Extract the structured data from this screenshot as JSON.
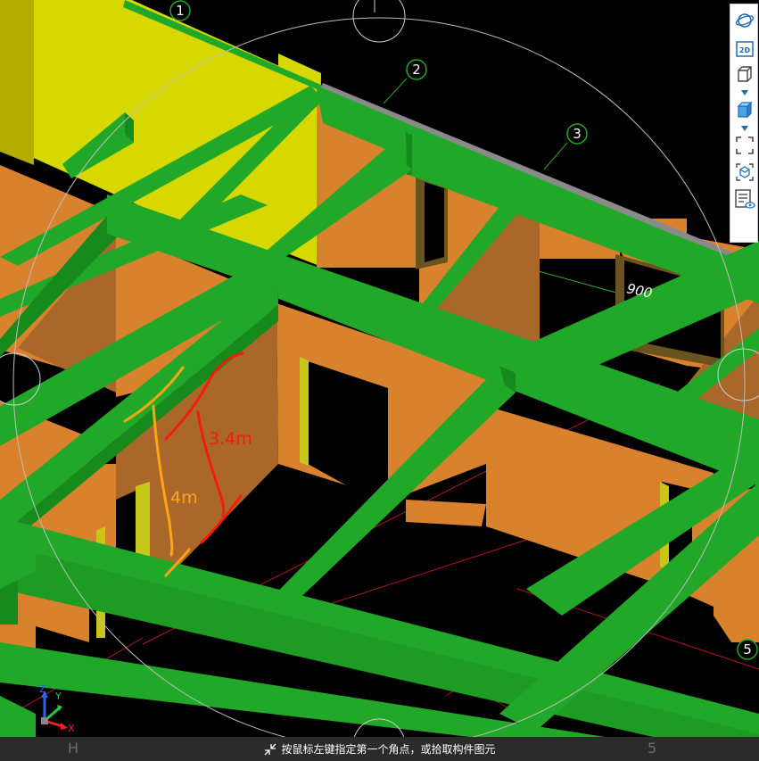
{
  "axis_markers": {
    "top": [
      "1",
      "2",
      "3"
    ],
    "right": "5"
  },
  "dimension_label": "900",
  "annotations": {
    "orange_height": "4m",
    "red_height": "3.4m"
  },
  "colors": {
    "beam": "#22a828",
    "beam_dark": "#168a1c",
    "wall": "#d8822e",
    "wall_dark": "#a9672a",
    "slab": "#d7d800",
    "annotation_orange": "#ffa414",
    "annotation_red": "#f41c0c"
  },
  "toolbar": {
    "buttons": [
      {
        "name": "orbit-view-icon"
      },
      {
        "name": "2d-view-icon",
        "text": "2D"
      },
      {
        "name": "3d-wireframe-box-icon"
      },
      {
        "name": "3d-solid-box-icon"
      },
      {
        "name": "fullscreen-icon"
      },
      {
        "name": "dynamic-observe-icon"
      },
      {
        "name": "properties-display-icon"
      }
    ]
  },
  "triad": {
    "z": "Z",
    "y": "Y",
    "x": "X"
  },
  "status_bar": {
    "prompt": "按鼠标左键指定第一个角点，或拾取构件图元",
    "ghost_left": "H",
    "ghost_right": "5"
  }
}
